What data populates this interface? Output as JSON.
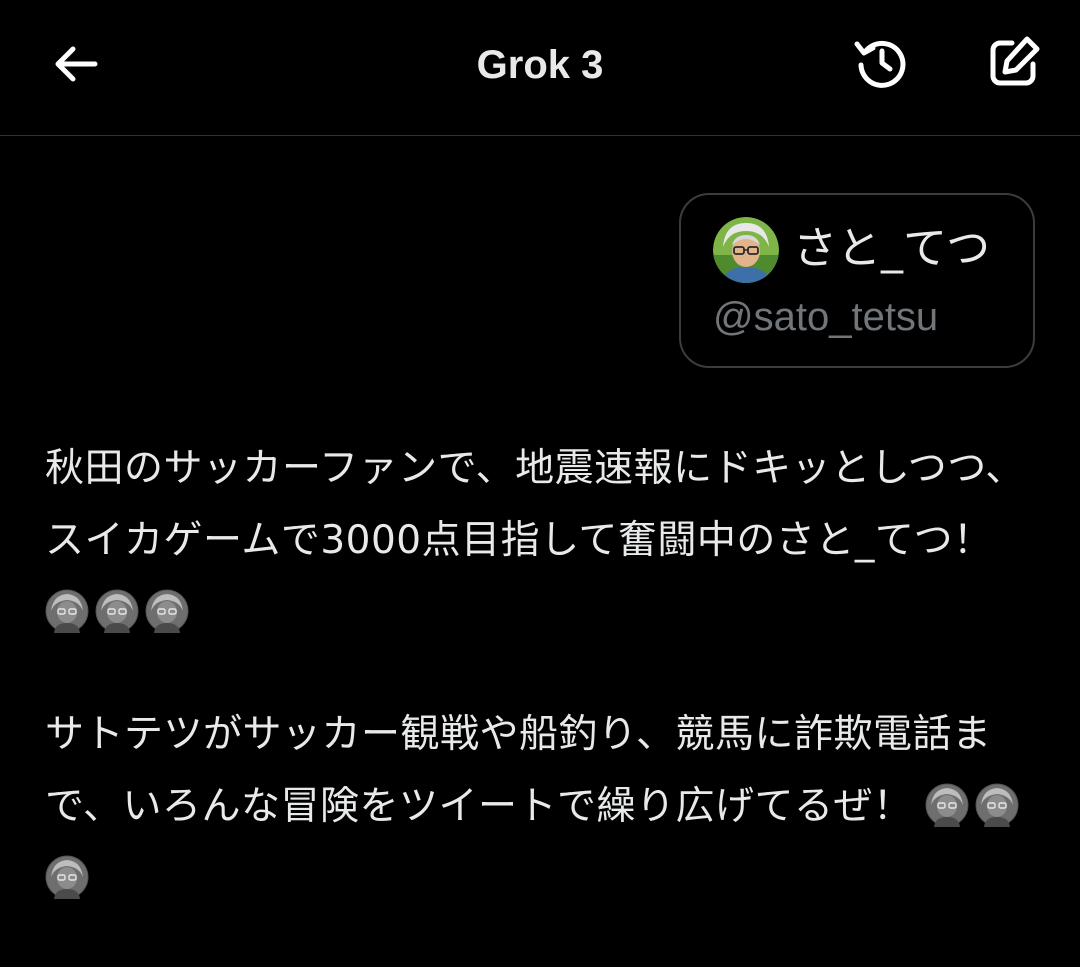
{
  "header": {
    "title": "Grok 3",
    "back_icon": "arrow-left-icon",
    "history_icon": "history-icon",
    "edit_icon": "compose-icon"
  },
  "user_card": {
    "display_name": "さと_てつ",
    "handle": "@sato_tetsu"
  },
  "messages": [
    {
      "text": "秋田のサッカーファンで、地震速報にドキッとしつつ、スイカゲームで3000点目指して奮闘中のさと_てつ！",
      "emoji_count": 3
    },
    {
      "text": "サトテツがサッカー観戦や船釣り、競馬に詐欺電話まで、いろんな冒険をツイートで繰り広げてるぜ！",
      "emoji_count": 3
    }
  ],
  "colors": {
    "background": "#000000",
    "text": "#e7e9ea",
    "muted": "#71767b",
    "border": "#2f3336"
  }
}
